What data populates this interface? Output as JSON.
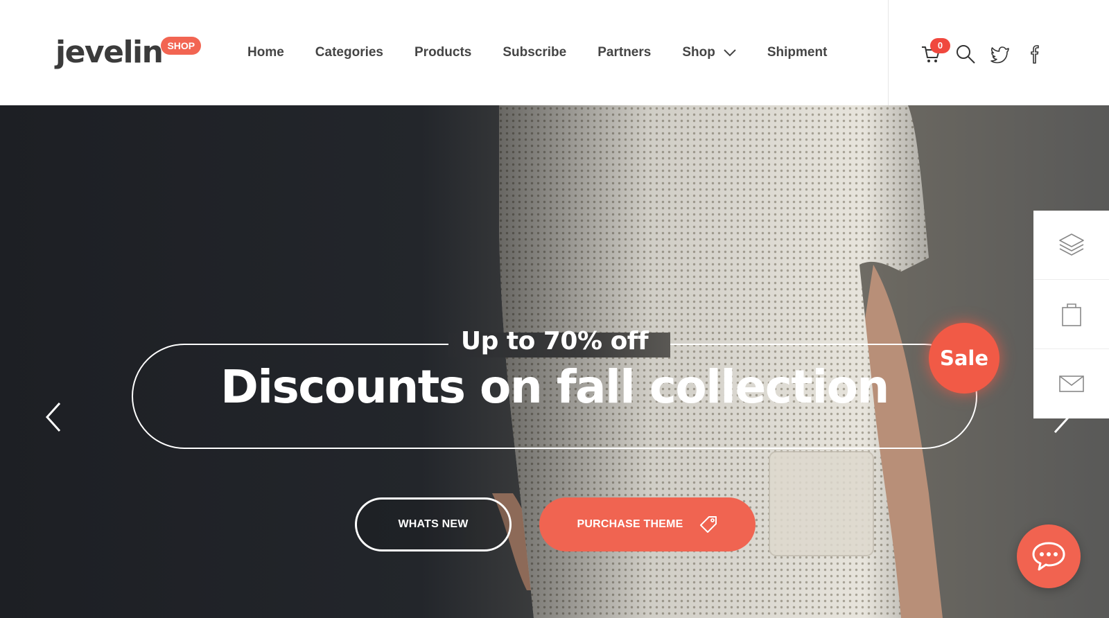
{
  "brand": {
    "logo_text": "jevelin",
    "logo_badge": "SHOP",
    "accent_color": "#f26552"
  },
  "nav": {
    "items": [
      {
        "label": "Home"
      },
      {
        "label": "Categories"
      },
      {
        "label": "Products"
      },
      {
        "label": "Subscribe"
      },
      {
        "label": "Partners"
      },
      {
        "label": "Shop",
        "has_dropdown": true
      },
      {
        "label": "Shipment"
      }
    ]
  },
  "header_icons": {
    "cart_count": "0",
    "icons": [
      "cart-icon",
      "search-icon",
      "twitter-icon",
      "facebook-icon"
    ]
  },
  "hero": {
    "subtitle": "Up to 70% off",
    "headline": "Discounts on fall collection",
    "sale_badge": "Sale",
    "buttons": {
      "whats_new": "WHATS NEW",
      "purchase": "PURCHASE THEME"
    }
  },
  "side_panel": {
    "icons": [
      "layers-icon",
      "shopping-bag-icon",
      "mail-icon"
    ]
  },
  "chat": {
    "icon": "chat-bubble-icon"
  }
}
